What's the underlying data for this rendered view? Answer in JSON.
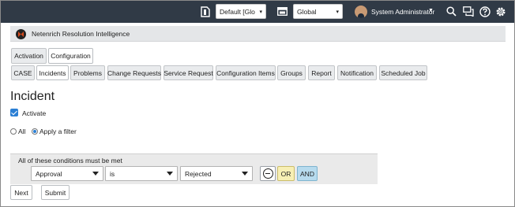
{
  "header": {
    "update_set_value": "Default [Glo",
    "app_scope_value": "Global",
    "user_name": "System Administrator"
  },
  "banner": {
    "app_title": "Netenrich Resolution Intelligence"
  },
  "top_tabs": [
    {
      "label": "Activation"
    },
    {
      "label": "Configuration"
    }
  ],
  "config_tabs": [
    {
      "label": "CASE"
    },
    {
      "label": "Incidents"
    },
    {
      "label": "Problems"
    },
    {
      "label": "Change Requests"
    },
    {
      "label": "Service Request"
    },
    {
      "label": "Configuration Items"
    },
    {
      "label": "Groups"
    },
    {
      "label": "Report"
    },
    {
      "label": "Notification"
    },
    {
      "label": "Scheduled Job"
    }
  ],
  "page": {
    "title": "Incident",
    "activate_label": "Activate",
    "activate_checked": true,
    "radio_all": "All",
    "radio_filter": "Apply a filter",
    "selected_radio": "Apply a filter"
  },
  "conditions": {
    "heading": "All of these conditions must be met",
    "field": "Approval",
    "operator": "is",
    "value": "Rejected",
    "or_label": "OR",
    "and_label": "AND"
  },
  "footer": {
    "next_label": "Next",
    "submit_label": "Submit"
  },
  "colors": {
    "header_bg": "#303a46",
    "accent": "#2b7fd4",
    "or_bg": "#f7efb4",
    "and_bg": "#b7dbee"
  }
}
